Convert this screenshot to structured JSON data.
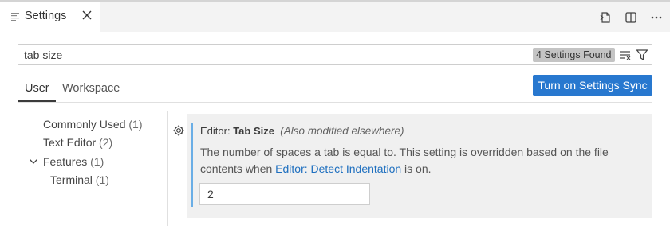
{
  "tab": {
    "title": "Settings",
    "icon": "settings-list-icon",
    "close_icon": "close-icon"
  },
  "actions": [
    "open-settings-json-icon",
    "split-editor-icon",
    "more-actions-icon"
  ],
  "search": {
    "value": "tab size",
    "badge": "4 Settings Found",
    "clear_icon": "clear-filter-icon",
    "filter_icon": "filter-icon"
  },
  "scopes": {
    "user": "User",
    "workspace": "Workspace"
  },
  "sync_button": "Turn on Settings Sync",
  "toc": [
    {
      "label": "Commonly Used",
      "count": "(1)"
    },
    {
      "label": "Text Editor",
      "count": "(2)"
    },
    {
      "label": "Features",
      "count": "(1)"
    },
    {
      "label": "Terminal",
      "count": "(1)"
    }
  ],
  "setting": {
    "category": "Editor: ",
    "name": "Tab Size",
    "modified": "(Also modified elsewhere)",
    "desc_part1": "The number of spaces a tab is equal to. This setting is overridden based on the file contents when ",
    "desc_link": "Editor: Detect Indentation",
    "desc_part2": " is on.",
    "value": "2"
  },
  "colors": {
    "accent": "#2878cf",
    "link": "#1e6fbf",
    "focus_bar": "#6aaee6"
  }
}
